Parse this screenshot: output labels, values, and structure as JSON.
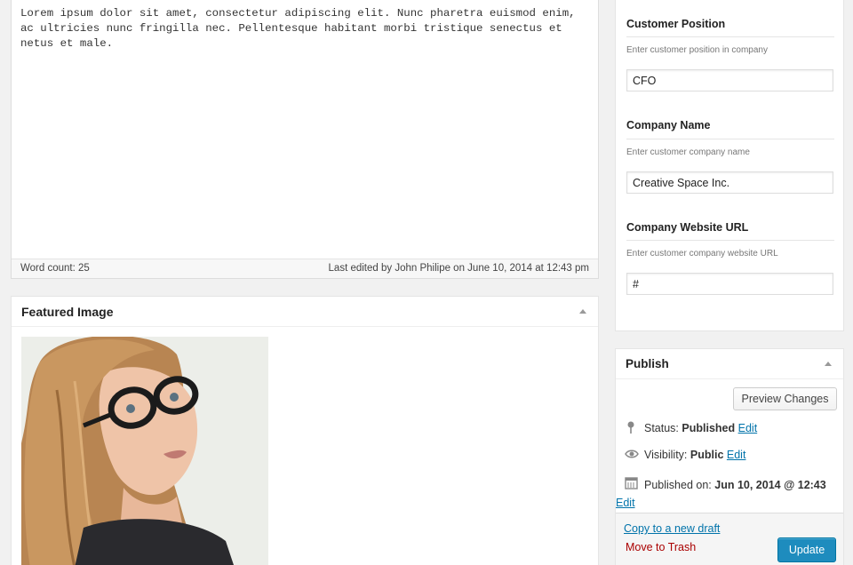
{
  "editor": {
    "content": "Lorem ipsum dolor sit amet, consectetur adipiscing elit. Nunc pharetra euismod enim, ac ultricies nunc fringilla nec. Pellentesque habitant morbi tristique senectus et netus et male.",
    "word_count": "Word count: 25",
    "last_edited": "Last edited by John Philipe on June 10, 2014 at 12:43 pm"
  },
  "featured_image": {
    "title": "Featured Image"
  },
  "fields": [
    {
      "title": "Customer Position",
      "description": "Enter customer position in company",
      "value": "CFO"
    },
    {
      "title": "Company Name",
      "description": "Enter customer company name",
      "value": "Creative Space Inc."
    },
    {
      "title": "Company Website URL",
      "description": "Enter customer company website URL",
      "value": "#"
    }
  ],
  "publish": {
    "title": "Publish",
    "preview_label": "Preview Changes",
    "status_label": "Status:",
    "status_value": "Published",
    "visibility_label": "Visibility:",
    "visibility_value": "Public",
    "published_label": "Published on:",
    "published_value": "Jun 10, 2014 @ 12:43",
    "edit_label": "Edit",
    "copy_draft_label": "Copy to a new draft",
    "trash_label": "Move to Trash",
    "update_label": "Update"
  },
  "colors": {
    "accent": "#1e8cbe",
    "link": "#0073aa",
    "trash": "#aa0000",
    "background": "#f1f1f1"
  }
}
